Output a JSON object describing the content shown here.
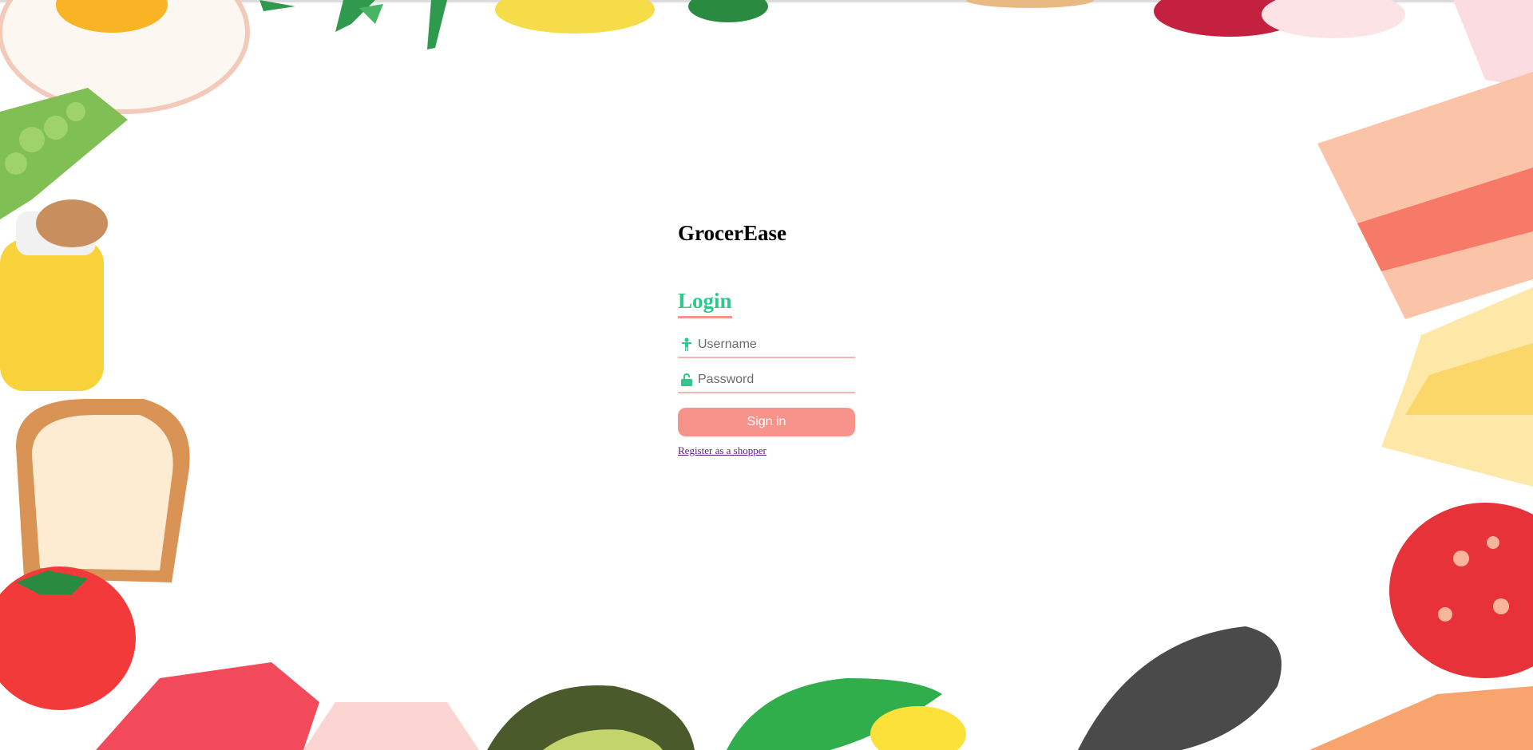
{
  "app": {
    "brand": "GrocerEase"
  },
  "login": {
    "title": "Login",
    "username_placeholder": "Username",
    "password_placeholder": "Password",
    "signin_label": "Sign in",
    "register_link": "Register as a shopper"
  },
  "icons": {
    "username": "person-icon",
    "password": "unlocked-padlock-icon"
  },
  "colors": {
    "accent_green": "#2dc98a",
    "accent_salmon": "#f7938a",
    "link_visited": "#551a8b"
  }
}
